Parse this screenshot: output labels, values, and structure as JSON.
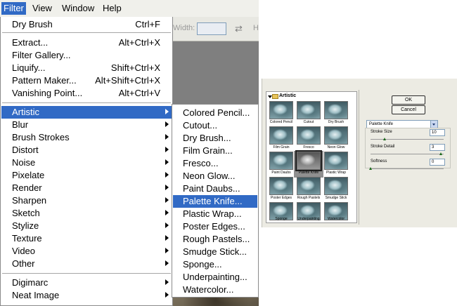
{
  "menubar": {
    "items": [
      {
        "label": "Filter",
        "active": true
      },
      {
        "label": "View"
      },
      {
        "label": "Window"
      },
      {
        "label": "Help"
      }
    ]
  },
  "options_bar": {
    "width_label": "Width:",
    "height_label": "H"
  },
  "filter_menu": {
    "items": [
      {
        "label": "Dry Brush",
        "shortcut": "Ctrl+F"
      },
      {
        "label": "Extract...",
        "shortcut": "Alt+Ctrl+X"
      },
      {
        "label": "Filter Gallery..."
      },
      {
        "label": "Liquify...",
        "shortcut": "Shift+Ctrl+X"
      },
      {
        "label": "Pattern Maker...",
        "shortcut": "Alt+Shift+Ctrl+X"
      },
      {
        "label": "Vanishing Point...",
        "shortcut": "Alt+Ctrl+V"
      },
      {
        "label": "Artistic",
        "submenu": true,
        "highlighted": true
      },
      {
        "label": "Blur",
        "submenu": true
      },
      {
        "label": "Brush Strokes",
        "submenu": true
      },
      {
        "label": "Distort",
        "submenu": true
      },
      {
        "label": "Noise",
        "submenu": true
      },
      {
        "label": "Pixelate",
        "submenu": true
      },
      {
        "label": "Render",
        "submenu": true
      },
      {
        "label": "Sharpen",
        "submenu": true
      },
      {
        "label": "Sketch",
        "submenu": true
      },
      {
        "label": "Stylize",
        "submenu": true
      },
      {
        "label": "Texture",
        "submenu": true
      },
      {
        "label": "Video",
        "submenu": true
      },
      {
        "label": "Other",
        "submenu": true
      },
      {
        "label": "Digimarc",
        "submenu": true
      },
      {
        "label": "Neat Image",
        "submenu": true
      }
    ]
  },
  "artistic_submenu": {
    "items": [
      {
        "label": "Colored Pencil..."
      },
      {
        "label": "Cutout..."
      },
      {
        "label": "Dry Brush..."
      },
      {
        "label": "Film Grain..."
      },
      {
        "label": "Fresco..."
      },
      {
        "label": "Neon Glow..."
      },
      {
        "label": "Paint Daubs..."
      },
      {
        "label": "Palette Knife...",
        "highlighted": true
      },
      {
        "label": "Plastic Wrap..."
      },
      {
        "label": "Poster Edges..."
      },
      {
        "label": "Rough Pastels..."
      },
      {
        "label": "Smudge Stick..."
      },
      {
        "label": "Sponge..."
      },
      {
        "label": "Underpainting..."
      },
      {
        "label": "Watercolor..."
      }
    ]
  },
  "gallery": {
    "category": "Artistic",
    "thumbnails": [
      {
        "label": "Colored Pencil"
      },
      {
        "label": "Cutout"
      },
      {
        "label": "Dry Brush"
      },
      {
        "label": "Film Grain"
      },
      {
        "label": "Fresco"
      },
      {
        "label": "Neon Glow"
      },
      {
        "label": "Paint Daubs"
      },
      {
        "label": "Palette Knife",
        "selected": true
      },
      {
        "label": "Plastic Wrap"
      },
      {
        "label": "Poster Edges"
      },
      {
        "label": "Rough Pastels"
      },
      {
        "label": "Smudge Stick"
      },
      {
        "label": "Sponge"
      },
      {
        "label": "Underpainting"
      },
      {
        "label": "Watercolor"
      }
    ],
    "ok_label": "OK",
    "cancel_label": "Cancel",
    "filter_select": "Palette Knife",
    "params": [
      {
        "label": "Stroke Size",
        "value": "10",
        "fraction": 0.2
      },
      {
        "label": "Stroke Detail",
        "value": "3",
        "fraction": 1.0
      },
      {
        "label": "Softness",
        "value": "0",
        "fraction": 0.0
      }
    ]
  },
  "colors": {
    "menu_highlight": "#316ac5",
    "menubar_bg": "#f0f0eb",
    "gallery_bg": "#ecebe3"
  }
}
